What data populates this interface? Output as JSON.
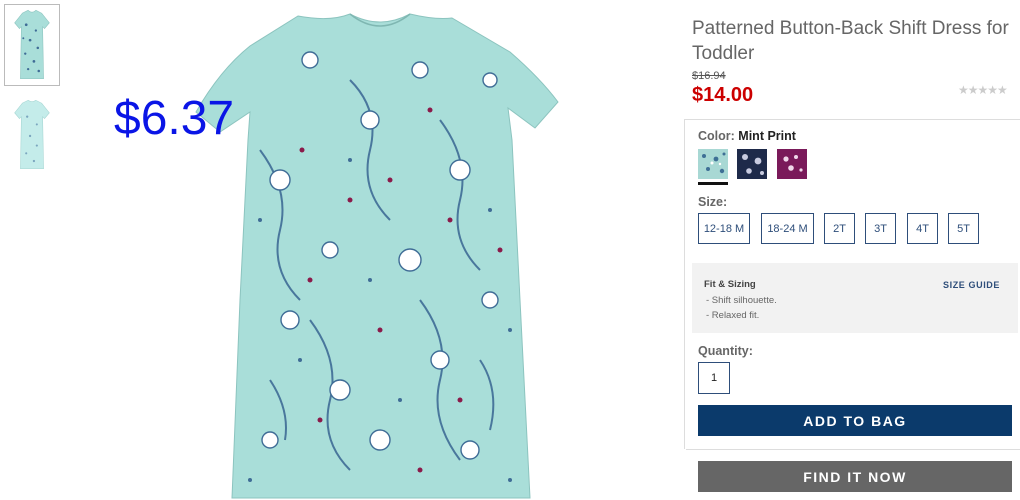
{
  "product": {
    "title": "Patterned Button-Back Shift Dress for Toddler",
    "old_price": "$16.94",
    "price": "$14.00",
    "overlay_price": "$6.37",
    "rating_stars": "★★★★★"
  },
  "color": {
    "label": "Color:",
    "selected": "Mint Print",
    "swatches": [
      {
        "name": "Mint Print",
        "bg": "#a8d8d4",
        "fg": "#3e6f95"
      },
      {
        "name": "Navy Print",
        "bg": "#1e2a4a",
        "fg": "#c8cbe0"
      },
      {
        "name": "Purple Print",
        "bg": "#7a1a5a",
        "fg": "#f0d8ea"
      }
    ]
  },
  "size": {
    "label": "Size:",
    "options": [
      "12-18 M",
      "18-24 M",
      "2T",
      "3T",
      "4T",
      "5T"
    ]
  },
  "fit": {
    "title": "Fit & Sizing",
    "guide_label": "SIZE GUIDE",
    "lines": [
      "- Shift silhouette.",
      "- Relaxed fit."
    ]
  },
  "quantity": {
    "label": "Quantity:",
    "value": "1"
  },
  "actions": {
    "add_to_bag": "ADD TO BAG",
    "find_it_now": "FIND IT NOW"
  },
  "colors": {
    "dress": "#a9ded9",
    "pattern_blue": "#3f6c96",
    "pattern_magenta": "#8a1a4a",
    "price_red": "#cc0000",
    "overlay_blue": "#0a15e6",
    "navy": "#0b3a6b"
  }
}
